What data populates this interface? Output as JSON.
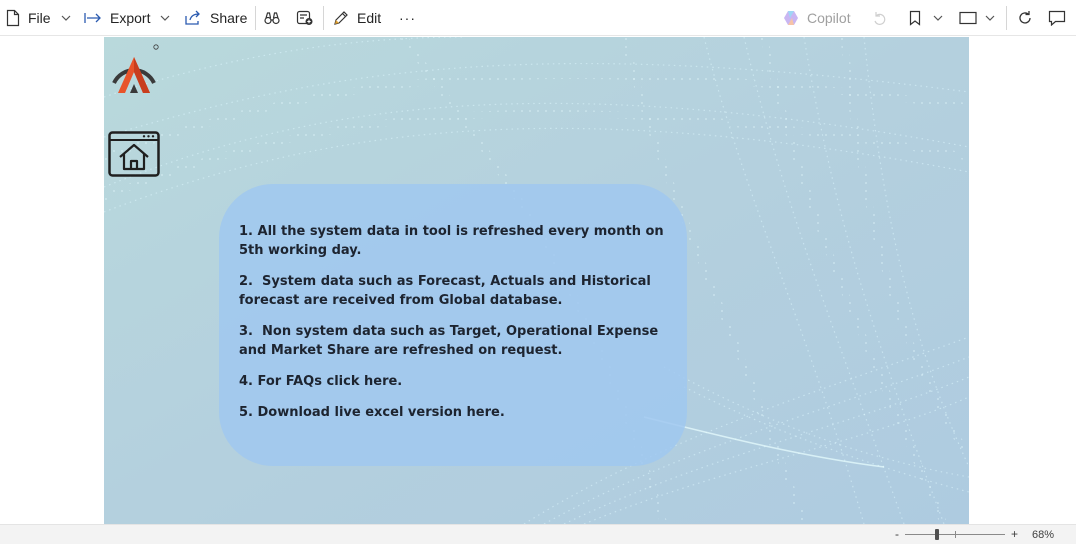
{
  "toolbar": {
    "file_label": "File",
    "export_label": "Export",
    "share_label": "Share",
    "edit_label": "Edit",
    "more_label": "···",
    "copilot_label": "Copilot",
    "icons": [
      "file-icon",
      "chevron-down-icon",
      "export-icon",
      "share-icon",
      "binoculars-icon",
      "add-comment-icon",
      "pencil-icon",
      "more-icon",
      "copilot-icon",
      "undo-icon",
      "bookmark-icon",
      "view-icon",
      "refresh-icon",
      "comment-icon"
    ]
  },
  "report": {
    "info_items": [
      "1. All the system data in tool is refreshed every month on 5th working day.",
      "2.  System data such as Forecast, Actuals and Historical forecast are received from Global database.",
      "3.  Non system data such as Target, Operational Expense and Market Share are refreshed on request.",
      "4. For FAQs click here.",
      "5. Download live excel version here."
    ],
    "colors": {
      "background": "#b6d3dc",
      "panel": "#a6cdf0",
      "logo_orange": "#e8542a",
      "logo_dark": "#3a3a3a"
    }
  },
  "status": {
    "zoom_minus": "-",
    "zoom_plus": "+",
    "zoom_level": "68%",
    "zoom_value": 68
  }
}
